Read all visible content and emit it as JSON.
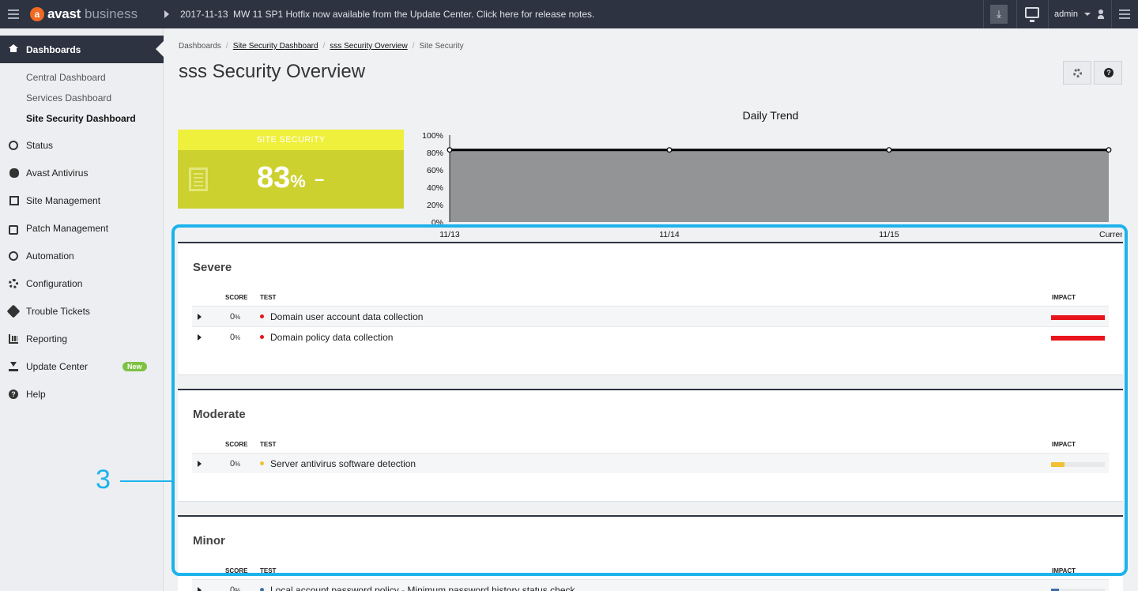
{
  "topbar": {
    "logo_text": "avast",
    "logo_suffix": "business",
    "logo_mark": "a",
    "date": "2017-11-13",
    "news": "MW 11 SP1 Hotfix now available from the Update Center. Click here for release notes.",
    "user": "admin",
    "pin_icon": "pin-icon",
    "monitor_icon": "monitor-icon"
  },
  "sidebar": {
    "active": {
      "label": "Dashboards",
      "icon": "home-icon"
    },
    "sub_items": [
      {
        "label": "Central Dashboard"
      },
      {
        "label": "Services Dashboard"
      },
      {
        "label": "Site Security Dashboard",
        "current": true
      }
    ],
    "items": [
      {
        "label": "Status",
        "icon": "gauge-icon"
      },
      {
        "label": "Avast Antivirus",
        "icon": "bug-icon"
      },
      {
        "label": "Site Management",
        "icon": "building-icon"
      },
      {
        "label": "Patch Management",
        "icon": "medkit-icon"
      },
      {
        "label": "Automation",
        "icon": "play-circle-icon"
      },
      {
        "label": "Configuration",
        "icon": "gears-icon"
      },
      {
        "label": "Trouble Tickets",
        "icon": "ticket-icon"
      },
      {
        "label": "Reporting",
        "icon": "bar-chart-icon"
      },
      {
        "label": "Update Center",
        "icon": "download-icon",
        "badge": "New"
      },
      {
        "label": "Help",
        "icon": "question-icon"
      }
    ]
  },
  "breadcrumb": {
    "items": [
      "Dashboards",
      "Site Security Dashboard",
      "sss Security Overview",
      "Site Security"
    ]
  },
  "page": {
    "title": "sss Security Overview"
  },
  "site_security": {
    "label": "SITE SECURITY",
    "value": "83",
    "unit": "%",
    "trend": "–"
  },
  "chart_data": {
    "type": "area",
    "title": "Daily Trend",
    "x": [
      "11/13",
      "11/14",
      "11/15",
      "Current"
    ],
    "series": [
      {
        "values": [
          83,
          83,
          83,
          83
        ]
      }
    ],
    "ylim": [
      0,
      100
    ],
    "yticks": [
      "100%",
      "80%",
      "60%",
      "40%",
      "20%",
      "0%"
    ],
    "xlabel": "",
    "ylabel": "",
    "fill_color": "#939496",
    "line_color": "#000000"
  },
  "columns": {
    "score": "SCORE",
    "test": "TEST",
    "impact": "IMPACT"
  },
  "sections": [
    {
      "title": "Severe",
      "rows": [
        {
          "score": "0",
          "unit": "%",
          "test": "Domain user account data collection",
          "color": "#e8141b",
          "impact": 1.0
        },
        {
          "score": "0",
          "unit": "%",
          "test": "Domain policy data collection",
          "color": "#e8141b",
          "impact": 1.0
        }
      ]
    },
    {
      "title": "Moderate",
      "rows": [
        {
          "score": "0",
          "unit": "%",
          "test": "Server antivirus software detection",
          "color": "#f2c032",
          "impact": 0.25
        }
      ]
    },
    {
      "title": "Minor",
      "rows": [
        {
          "score": "0",
          "unit": "%",
          "test": "Local account password policy - Minimum password history status check",
          "color": "#3f6fa8",
          "impact": 0.15
        }
      ]
    }
  ],
  "annotation": {
    "label": "3",
    "color": "#1db3ec"
  }
}
